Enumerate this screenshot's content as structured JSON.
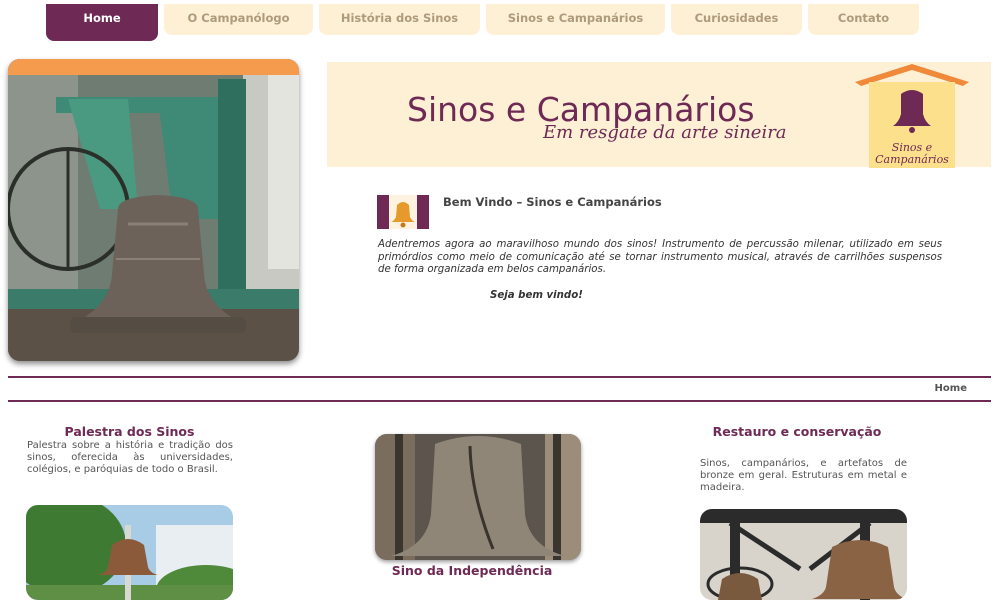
{
  "nav": {
    "items": [
      {
        "label": "Home",
        "active": true
      },
      {
        "label": "O Campanólogo"
      },
      {
        "label": "História dos Sinos"
      },
      {
        "label": "Sinos e Campanários"
      },
      {
        "label": "Curiosidades"
      },
      {
        "label": "Contato"
      }
    ]
  },
  "banner": {
    "title": "Sinos e Campanários",
    "subtitle": "Em resgate da arte sineira",
    "logo_line1": "Sinos e",
    "logo_line2": "Campanários"
  },
  "welcome": {
    "title": "Bem Vindo – Sinos e Campanários",
    "body": "Adentremos agora ao maravilhoso mundo dos sinos! Instrumento de percussão milenar, utilizado em seus primórdios como meio de comunicação até se tornar instrumento musical, através de carrilhões suspensos de forma organizada em belos campanários.",
    "greeting": "Seja bem vindo!"
  },
  "breadcrumb": {
    "label": "Home"
  },
  "columns": [
    {
      "title": "Palestra dos Sinos",
      "text": "Palestra sobre a história e tradição dos sinos, oferecida às universidades, colégios, e paróquias de todo o Brasil."
    },
    {
      "title": "Sino da Independência",
      "text": ""
    },
    {
      "title": "Restauro e conservação",
      "text": "Sinos, campanários, e artefatos de bronze em geral. Estruturas em metal e madeira."
    }
  ],
  "colors": {
    "accent": "#6e2a55",
    "nav_bg": "#fdf0d4",
    "hero_bar": "#f49b4d"
  }
}
